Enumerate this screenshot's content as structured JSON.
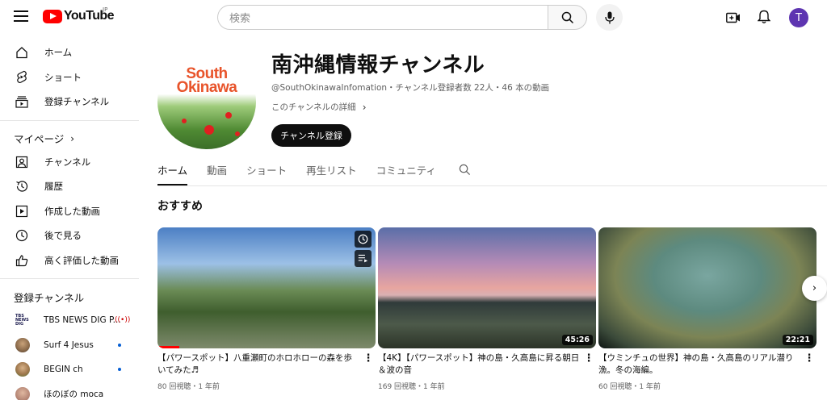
{
  "header": {
    "logo_text": "YouTube",
    "logo_region": "JP",
    "search_placeholder": "検索",
    "avatar_letter": "T"
  },
  "sidebar": {
    "main": [
      {
        "label": "ホーム",
        "icon": "home-icon"
      },
      {
        "label": "ショート",
        "icon": "shorts-icon"
      },
      {
        "label": "登録チャンネル",
        "icon": "subscriptions-icon"
      }
    ],
    "mypage_label": "マイページ",
    "mypage": [
      {
        "label": "チャンネル",
        "icon": "channel-icon"
      },
      {
        "label": "履歴",
        "icon": "history-icon"
      },
      {
        "label": "作成した動画",
        "icon": "your-videos-icon"
      },
      {
        "label": "後で見る",
        "icon": "watch-later-icon"
      },
      {
        "label": "高く評価した動画",
        "icon": "liked-icon"
      }
    ],
    "subs_label": "登録チャンネル",
    "subscriptions": [
      {
        "name": "TBS NEWS DIG P...",
        "badge": "live",
        "logo_text": "TBS NEWS DIG"
      },
      {
        "name": "Surf 4 Jesus",
        "badge": "dot"
      },
      {
        "name": "BEGIN ch",
        "badge": "dot"
      },
      {
        "name": "ほのぼの moca",
        "badge": ""
      }
    ]
  },
  "channel": {
    "avatar_text_1": "South",
    "avatar_text_2": "Okinawa",
    "title": "南沖縄情報チャンネル",
    "meta": "@SouthOkinawaInfomation・チャンネル登録者数 22人・46 本の動画",
    "more_label": "このチャンネルの詳細",
    "subscribe_label": "チャンネル登録"
  },
  "tabs": [
    {
      "label": "ホーム",
      "active": true
    },
    {
      "label": "動画",
      "active": false
    },
    {
      "label": "ショート",
      "active": false
    },
    {
      "label": "再生リスト",
      "active": false
    },
    {
      "label": "コミュニティ",
      "active": false
    }
  ],
  "section_title": "おすすめ",
  "videos": [
    {
      "title": "【パワースポット】八重瀬町のホロホローの森を歩いてみた♬",
      "meta": "80 回視聴・1 年前",
      "duration": "",
      "progress": 0.1
    },
    {
      "title": "【4K】【パワースポット】神の島・久高島に昇る朝日＆波の音",
      "meta": "169 回視聴・1 年前",
      "duration": "45:26",
      "progress": 0
    },
    {
      "title": "【ウミンチュの世界】神の島・久高島のリアル潜り漁。冬の海編。",
      "meta": "60 回視聴・1 年前",
      "duration": "22:21",
      "progress": 0
    }
  ],
  "colors": {
    "brand_red": "#ff0000",
    "avatar_purple": "#5e35b1",
    "live_red": "#cc0000",
    "new_dot": "#065fd4"
  }
}
